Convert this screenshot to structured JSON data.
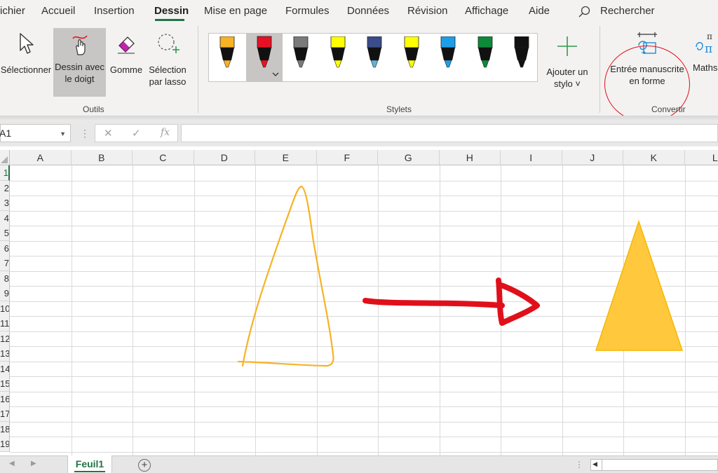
{
  "tabs": [
    {
      "label": "ichier"
    },
    {
      "label": "Accueil"
    },
    {
      "label": "Insertion"
    },
    {
      "label": "Dessin",
      "active": true
    },
    {
      "label": "Mise en page"
    },
    {
      "label": "Formules"
    },
    {
      "label": "Données"
    },
    {
      "label": "Révision"
    },
    {
      "label": "Affichage"
    },
    {
      "label": "Aide"
    }
  ],
  "search": {
    "label": "Rechercher",
    "icon": "search-icon"
  },
  "ribbon": {
    "tools": {
      "group_label": "Outils",
      "select_label": "Sélectionner",
      "finger_draw_line1": "Dessin avec",
      "finger_draw_line2": "le doigt",
      "eraser_label": "Gomme",
      "lasso_line1": "Sélection",
      "lasso_line2": "par lasso"
    },
    "pens": {
      "group_label": "Stylets",
      "items": [
        {
          "name": "pen-orange",
          "color": "#f7b225",
          "tip": "#f7b225"
        },
        {
          "name": "pen-red",
          "color": "#e81123",
          "tip": "#e81123",
          "selected": true
        },
        {
          "name": "pencil-grey",
          "color": "#7a7a7a",
          "tip": "#7a7a7a"
        },
        {
          "name": "highlighter-yellow",
          "color": "#ffff00",
          "tip": "#ffff00"
        },
        {
          "name": "pen-galaxy",
          "color": "#3a4c8a",
          "tip": "#5fb3d6"
        },
        {
          "name": "highlighter-yellow-2",
          "color": "#ffff00",
          "tip": "#ffff00"
        },
        {
          "name": "pen-blue",
          "color": "#1e9ee8",
          "tip": "#1e9ee8"
        },
        {
          "name": "pen-green",
          "color": "#0c8a3a",
          "tip": "#0c8a3a"
        },
        {
          "name": "pen-black",
          "color": "#111111",
          "tip": "#111111"
        }
      ],
      "add_pen_line1": "Ajouter un",
      "add_pen_line2": "stylo ˅"
    },
    "convert": {
      "group_label": "Convertir",
      "ink_to_shape_line1": "Entrée manuscrite",
      "ink_to_shape_line2": "en forme",
      "math_label": "Maths"
    }
  },
  "formula_bar": {
    "name_box": "A1",
    "cancel_symbol": "✕",
    "enter_symbol": "✓",
    "fx_symbol": "fx",
    "dots": "⋮",
    "value": ""
  },
  "grid": {
    "columns": [
      "A",
      "B",
      "C",
      "D",
      "E",
      "F",
      "G",
      "H",
      "I",
      "J",
      "K",
      "L"
    ],
    "rows": [
      "1",
      "2",
      "3",
      "4",
      "5",
      "6",
      "7",
      "8",
      "9",
      "10",
      "11",
      "12",
      "13",
      "14",
      "15",
      "16",
      "17",
      "18",
      "19"
    ]
  },
  "drawing": {
    "ink_triangle_color": "#f7b225",
    "arrow_color": "#e0101a",
    "shape_triangle_fill": "#ffc83d",
    "shape_triangle_stroke": "#f5b800"
  },
  "sheets": [
    {
      "label": "Feuil1",
      "active": true
    }
  ],
  "colors": {
    "accent": "#217346",
    "highlight_circle": "#e0101a"
  }
}
